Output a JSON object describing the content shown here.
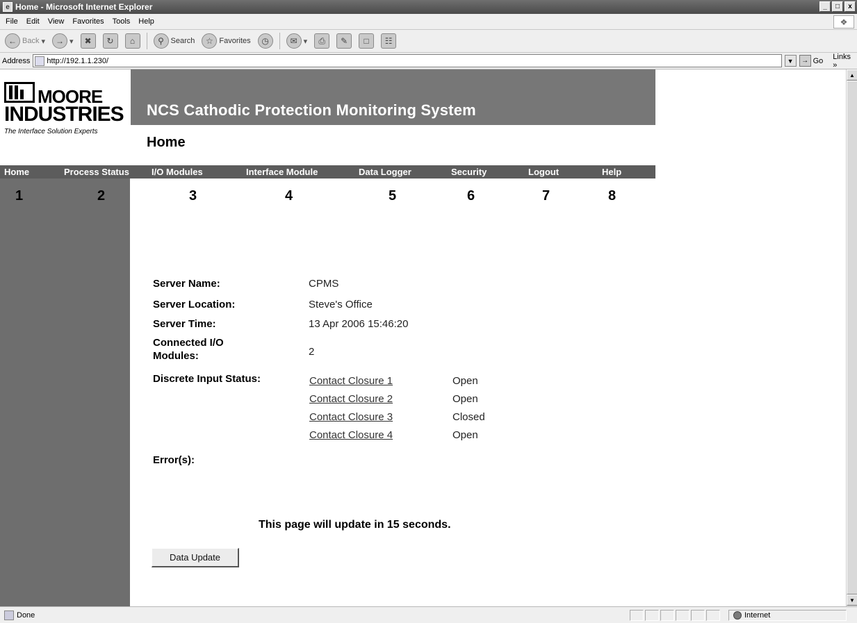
{
  "window": {
    "title": "Home - Microsoft Internet Explorer",
    "controls": [
      "_",
      "□",
      "x"
    ]
  },
  "menubar": {
    "items": [
      "File",
      "Edit",
      "View",
      "Favorites",
      "Tools",
      "Help"
    ]
  },
  "toolbar": {
    "back_label": "Back",
    "search_label": "Search",
    "favorites_label": "Favorites"
  },
  "addressbar": {
    "label": "Address",
    "url": "http://192.1.1.230/",
    "go_label": "Go",
    "links_label": "Links »"
  },
  "logo": {
    "moore": "MOORE",
    "industries": "INDUSTRIES",
    "tagline": "The Interface Solution Experts"
  },
  "header": {
    "site_title": "NCS Cathodic Protection Monitoring System",
    "page_title": "Home"
  },
  "nav": {
    "items": [
      {
        "label": "Home",
        "number": "1"
      },
      {
        "label": "Process Status",
        "number": "2"
      },
      {
        "label": "I/O Modules",
        "number": "3"
      },
      {
        "label": "Interface Module",
        "number": "4"
      },
      {
        "label": "Data Logger",
        "number": "5"
      },
      {
        "label": "Security",
        "number": "6"
      },
      {
        "label": "Logout",
        "number": "7"
      },
      {
        "label": "Help",
        "number": "8"
      }
    ]
  },
  "info": {
    "server_name_label": "Server Name:",
    "server_name": "CPMS",
    "server_location_label": "Server Location:",
    "server_location": "Steve's Office",
    "server_time_label": "Server Time:",
    "server_time": "13 Apr 2006 15:46:20",
    "connected_label_1": "Connected I/O",
    "connected_label_2": "Modules:",
    "connected_modules": "2",
    "discrete_label": "Discrete Input Status:",
    "discrete_inputs": [
      {
        "name": "Contact Closure 1",
        "state": "Open"
      },
      {
        "name": "Contact Closure 2",
        "state": "Open"
      },
      {
        "name": "Contact Closure 3",
        "state": "Closed"
      },
      {
        "name": "Contact Closure 4",
        "state": "Open"
      }
    ],
    "errors_label": "Error(s):"
  },
  "update": {
    "message": "This page will update in 15 seconds.",
    "button_label": "Data Update"
  },
  "statusbar": {
    "status": "Done",
    "zone": "Internet"
  }
}
